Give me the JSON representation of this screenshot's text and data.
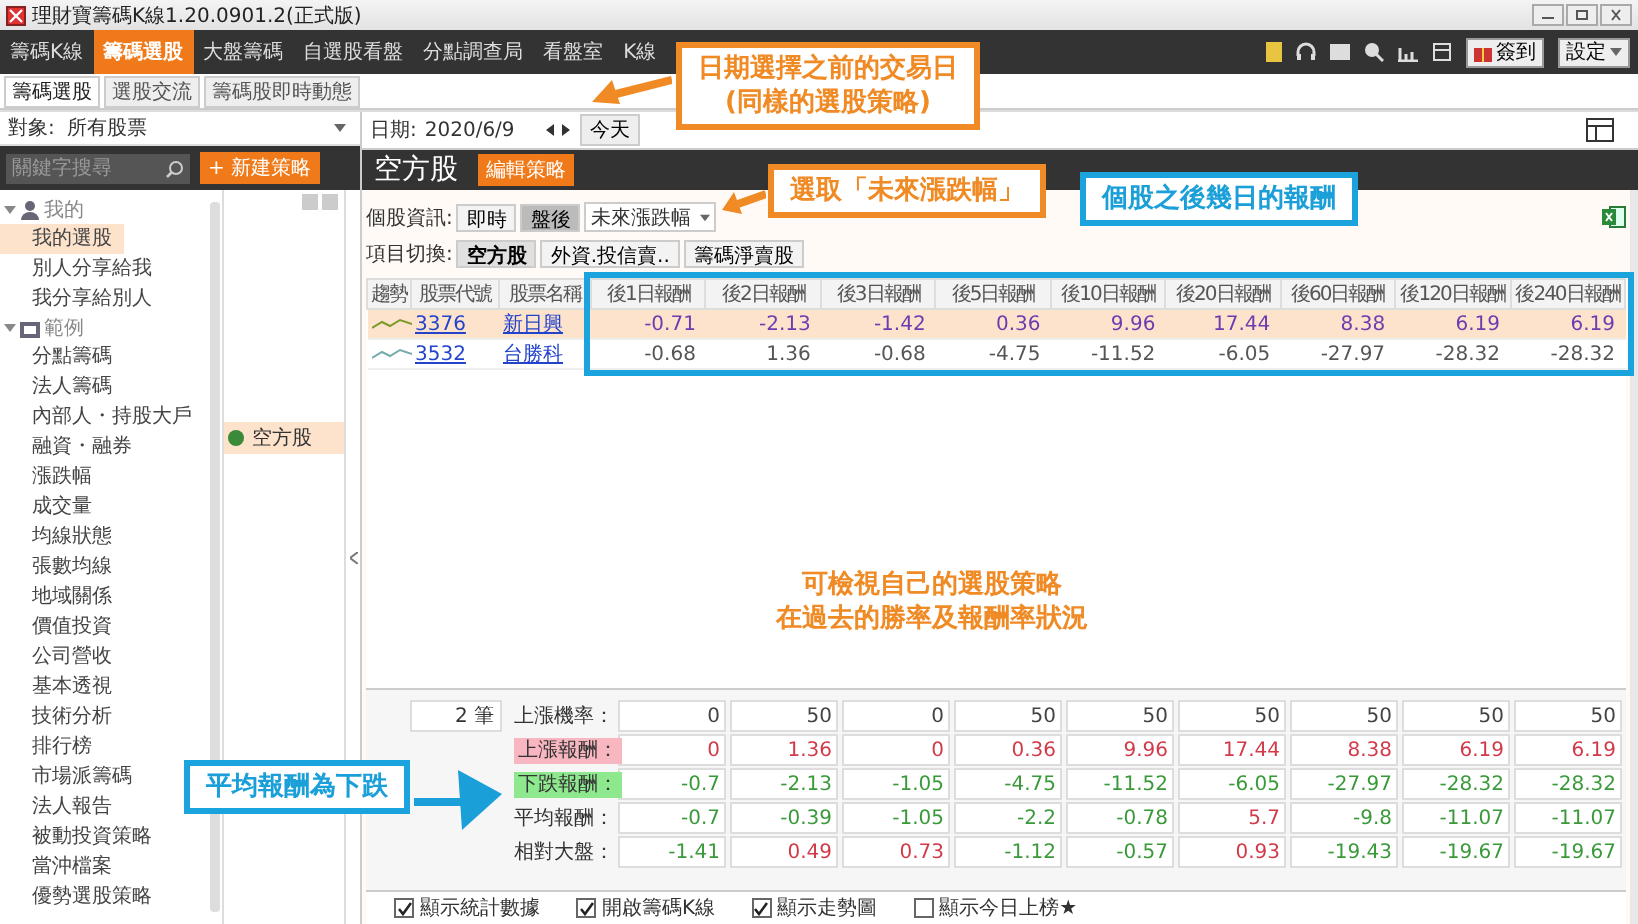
{
  "window": {
    "title": "理財寶籌碼K線1.20.0901.2(正式版)"
  },
  "nav": [
    {
      "label": "籌碼K線",
      "selected": false
    },
    {
      "label": "籌碼選股",
      "selected": true
    },
    {
      "label": "大盤籌碼",
      "selected": false
    },
    {
      "label": "自選股看盤",
      "selected": false
    },
    {
      "label": "分點調查局",
      "selected": false
    },
    {
      "label": "看盤室",
      "selected": false
    },
    {
      "label": "K線",
      "selected": false
    }
  ],
  "nav_right": {
    "checkin": "簽到",
    "settings": "設定"
  },
  "subtabs": [
    {
      "label": "籌碼選股",
      "selected": true
    },
    {
      "label": "選股交流",
      "selected": false
    },
    {
      "label": "籌碼股即時動態",
      "selected": false
    }
  ],
  "target": {
    "label": "對象:",
    "value": "所有股票"
  },
  "search": {
    "placeholder": "關鍵字搜尋"
  },
  "new_strategy": "+ 新建策略",
  "tree": [
    {
      "label": "我的",
      "expanded": true,
      "children": [
        {
          "label": "我的選股",
          "selected": true
        },
        {
          "label": "別人分享給我",
          "selected": false
        },
        {
          "label": "我分享給別人",
          "selected": false
        }
      ]
    },
    {
      "label": "範例",
      "expanded": true,
      "children": [
        {
          "label": "分點籌碼",
          "selected": false
        },
        {
          "label": "法人籌碼",
          "selected": false
        },
        {
          "label": "內部人・持股大戶",
          "selected": false
        },
        {
          "label": "融資・融券",
          "selected": false
        },
        {
          "label": "漲跌幅",
          "selected": false
        },
        {
          "label": "成交量",
          "selected": false
        },
        {
          "label": "均線狀態",
          "selected": false
        },
        {
          "label": "張數均線",
          "selected": false
        },
        {
          "label": "地域關係",
          "selected": false
        },
        {
          "label": "價值投資",
          "selected": false
        },
        {
          "label": "公司營收",
          "selected": false
        },
        {
          "label": "基本透視",
          "selected": false
        },
        {
          "label": "技術分析",
          "selected": false
        },
        {
          "label": "排行榜",
          "selected": false
        },
        {
          "label": "市場派籌碼",
          "selected": false
        },
        {
          "label": "法人報告",
          "selected": false
        },
        {
          "label": "被動投資策略",
          "selected": false
        },
        {
          "label": "當沖檔案",
          "selected": false
        },
        {
          "label": "優勢選股策略",
          "selected": false
        }
      ]
    }
  ],
  "strategies": [
    {
      "label": "空方股",
      "selected": true,
      "color": "#3a8a3a"
    }
  ],
  "date": {
    "label": "日期:",
    "value": "2020/6/9",
    "today": "今天"
  },
  "strategy_header": {
    "title": "空方股",
    "edit": "編輯策略"
  },
  "info": {
    "label": "個股資訊:",
    "modes": [
      {
        "label": "即時",
        "selected": false
      },
      {
        "label": "盤後",
        "selected": true
      }
    ],
    "dropdown": "未來漲跌幅"
  },
  "switch": {
    "label": "項目切換:",
    "items": [
      {
        "label": "空方股",
        "selected": true
      },
      {
        "label": "外資.投信賣..",
        "selected": false
      },
      {
        "label": "籌碼淨賣股",
        "selected": false
      }
    ]
  },
  "table": {
    "columns": [
      "趨勢",
      "股票代號",
      "股票名稱",
      "後1日報酬",
      "後2日報酬",
      "後3日報酬",
      "後5日報酬",
      "後10日報酬",
      "後20日報酬",
      "後60日報酬",
      "後120日報酬",
      "後240日報酬"
    ],
    "rows": [
      {
        "code": "3376",
        "name": "新日興",
        "selected": true,
        "values": [
          "-0.71",
          "-2.13",
          "-1.42",
          "0.36",
          "9.96",
          "17.44",
          "8.38",
          "6.19",
          "6.19"
        ]
      },
      {
        "code": "3532",
        "name": "台勝科",
        "selected": false,
        "values": [
          "-0.68",
          "1.36",
          "-0.68",
          "-4.75",
          "-11.52",
          "-6.05",
          "-27.97",
          "-28.32",
          "-28.32"
        ]
      }
    ]
  },
  "stats": {
    "count": "2 筆",
    "rows": [
      {
        "label": "上漲機率：",
        "kind": "plain",
        "values": [
          "0",
          "50",
          "0",
          "50",
          "50",
          "50",
          "50",
          "50",
          "50"
        ]
      },
      {
        "label": "上漲報酬：",
        "kind": "up",
        "values": [
          "0",
          "1.36",
          "0",
          "0.36",
          "9.96",
          "17.44",
          "8.38",
          "6.19",
          "6.19"
        ]
      },
      {
        "label": "下跌報酬：",
        "kind": "down",
        "values": [
          "-0.7",
          "-2.13",
          "-1.05",
          "-4.75",
          "-11.52",
          "-6.05",
          "-27.97",
          "-28.32",
          "-28.32"
        ]
      },
      {
        "label": "平均報酬：",
        "kind": "signed",
        "values": [
          "-0.7",
          "-0.39",
          "-1.05",
          "-2.2",
          "-0.78",
          "5.7",
          "-9.8",
          "-11.07",
          "-11.07"
        ]
      },
      {
        "label": "相對大盤：",
        "kind": "signed",
        "values": [
          "-1.41",
          "0.49",
          "0.73",
          "-1.12",
          "-0.57",
          "0.93",
          "-19.43",
          "-19.67",
          "-19.67"
        ]
      }
    ]
  },
  "options": [
    {
      "label": "顯示統計數據",
      "checked": true
    },
    {
      "label": "開啟籌碼K線",
      "checked": true
    },
    {
      "label": "顯示走勢圖",
      "checked": true
    },
    {
      "label": "顯示今日上榜★",
      "checked": false
    }
  ],
  "callouts": [
    {
      "kind": "orange",
      "lines": [
        "日期選擇之前的交易日",
        "(同樣的選股策略)"
      ]
    },
    {
      "kind": "orange",
      "lines": [
        "選取「未來漲跌幅」"
      ]
    },
    {
      "kind": "blue",
      "lines": [
        "個股之後幾日的報酬"
      ]
    },
    {
      "kind": "orange",
      "lines": [
        "可檢視自己的選股策略",
        "在過去的勝率及報酬率狀況"
      ]
    },
    {
      "kind": "blue",
      "lines": [
        "平均報酬為下跌"
      ]
    }
  ]
}
